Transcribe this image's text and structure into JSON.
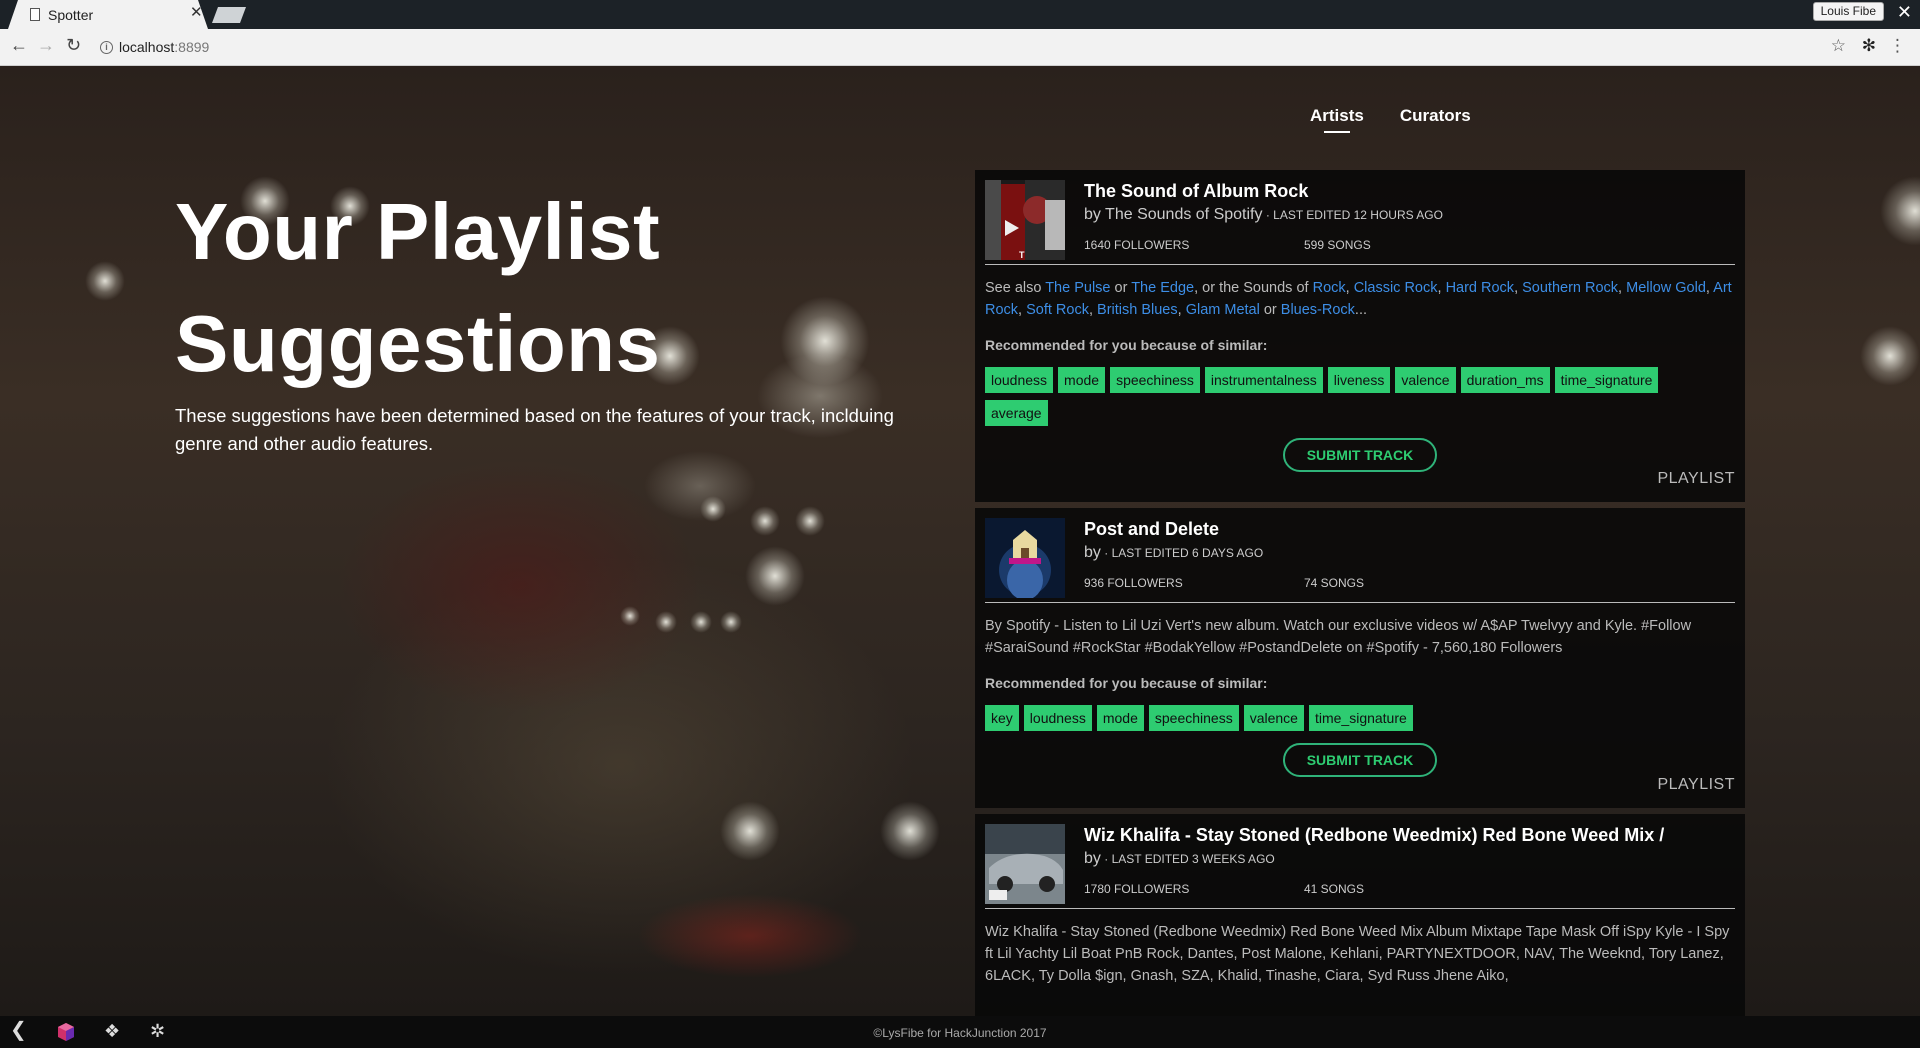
{
  "browser": {
    "tab_title": "Spotter",
    "url_host": "localhost",
    "url_port": ":8899",
    "user_name": "Louis Fibe"
  },
  "nav": {
    "items": [
      {
        "label": "Artists"
      },
      {
        "label": "Curators"
      }
    ]
  },
  "hero": {
    "title_line1": "Your Playlist",
    "title_line2": "Suggestions",
    "description": "These suggestions have been determined based on the features of your track, inclduing genre and other audio features."
  },
  "cards": [
    {
      "title": "The Sound of Album Rock",
      "by": "by The Sounds of Spotify",
      "edited": " · LAST EDITED 12 HOURS AGO",
      "followers": "1640 FOLLOWERS",
      "songs": "599 SONGS",
      "desc_parts": {
        "p1": "See also ",
        "l1": "The Pulse",
        "p2": " or ",
        "l2": "The Edge",
        "p3": ", or the Sounds of ",
        "l3": "Rock",
        "c1": ", ",
        "l4": "Classic Rock",
        "c2": ", ",
        "l5": "Hard Rock",
        "c3": ", ",
        "l6": "Southern Rock",
        "c4": ", ",
        "l7": "Mellow Gold",
        "c5": ", ",
        "l8": "Art Rock",
        "c6": ", ",
        "l9": "Soft Rock",
        "c7": ", ",
        "l10": "British Blues",
        "c8": ", ",
        "l11": "Glam Metal",
        "p4": " or ",
        "l12": "Blues-Rock",
        "p5": "..."
      },
      "rec_label": "Recommended for you because of similar:",
      "tags": [
        "loudness",
        "mode",
        "speechiness",
        "instrumentalness",
        "liveness",
        "valence",
        "duration_ms",
        "time_signature",
        "average"
      ],
      "submit": "SUBMIT TRACK",
      "type": "PLAYLIST"
    },
    {
      "title": "Post and Delete",
      "by": "by",
      "edited": " · LAST EDITED 6 DAYS AGO",
      "followers": "936 FOLLOWERS",
      "songs": "74 SONGS",
      "description": "By Spotify - Listen to Lil Uzi Vert's new album. Watch our exclusive videos w/ A$AP Twelvyy and Kyle. #Follow #SaraiSound #RockStar #BodakYellow #PostandDelete on #Spotify - 7,560,180 Followers",
      "rec_label": "Recommended for you because of similar:",
      "tags": [
        "key",
        "loudness",
        "mode",
        "speechiness",
        "valence",
        "time_signature"
      ],
      "submit": "SUBMIT TRACK",
      "type": "PLAYLIST"
    },
    {
      "title": "Wiz Khalifa - Stay Stoned (Redbone Weedmix) Red Bone Weed Mix /",
      "by": "by",
      "edited": " · LAST EDITED 3 WEEKS AGO",
      "followers": "1780 FOLLOWERS",
      "songs": "41 SONGS",
      "description": "Wiz Khalifa - Stay Stoned (Redbone Weedmix) Red Bone Weed Mix Album Mixtape Tape Mask Off iSpy Kyle - I Spy ft Lil Yachty Lil Boat PnB Rock, Dantes, Post Malone, Kehlani, PARTYNEXTDOOR, NAV, The Weeknd, Tory Lanez, 6LACK, Ty Dolla $ign, Gnash, SZA, Khalid, Tinashe, Ciara, Syd Russ Jhene Aiko,"
    }
  ],
  "footer": {
    "text": "©LysFibe for HackJunction 2017"
  },
  "colors": {
    "tag_bg": "#2ecc71",
    "link": "#3d8ee6",
    "button_border": "#2fb379"
  }
}
